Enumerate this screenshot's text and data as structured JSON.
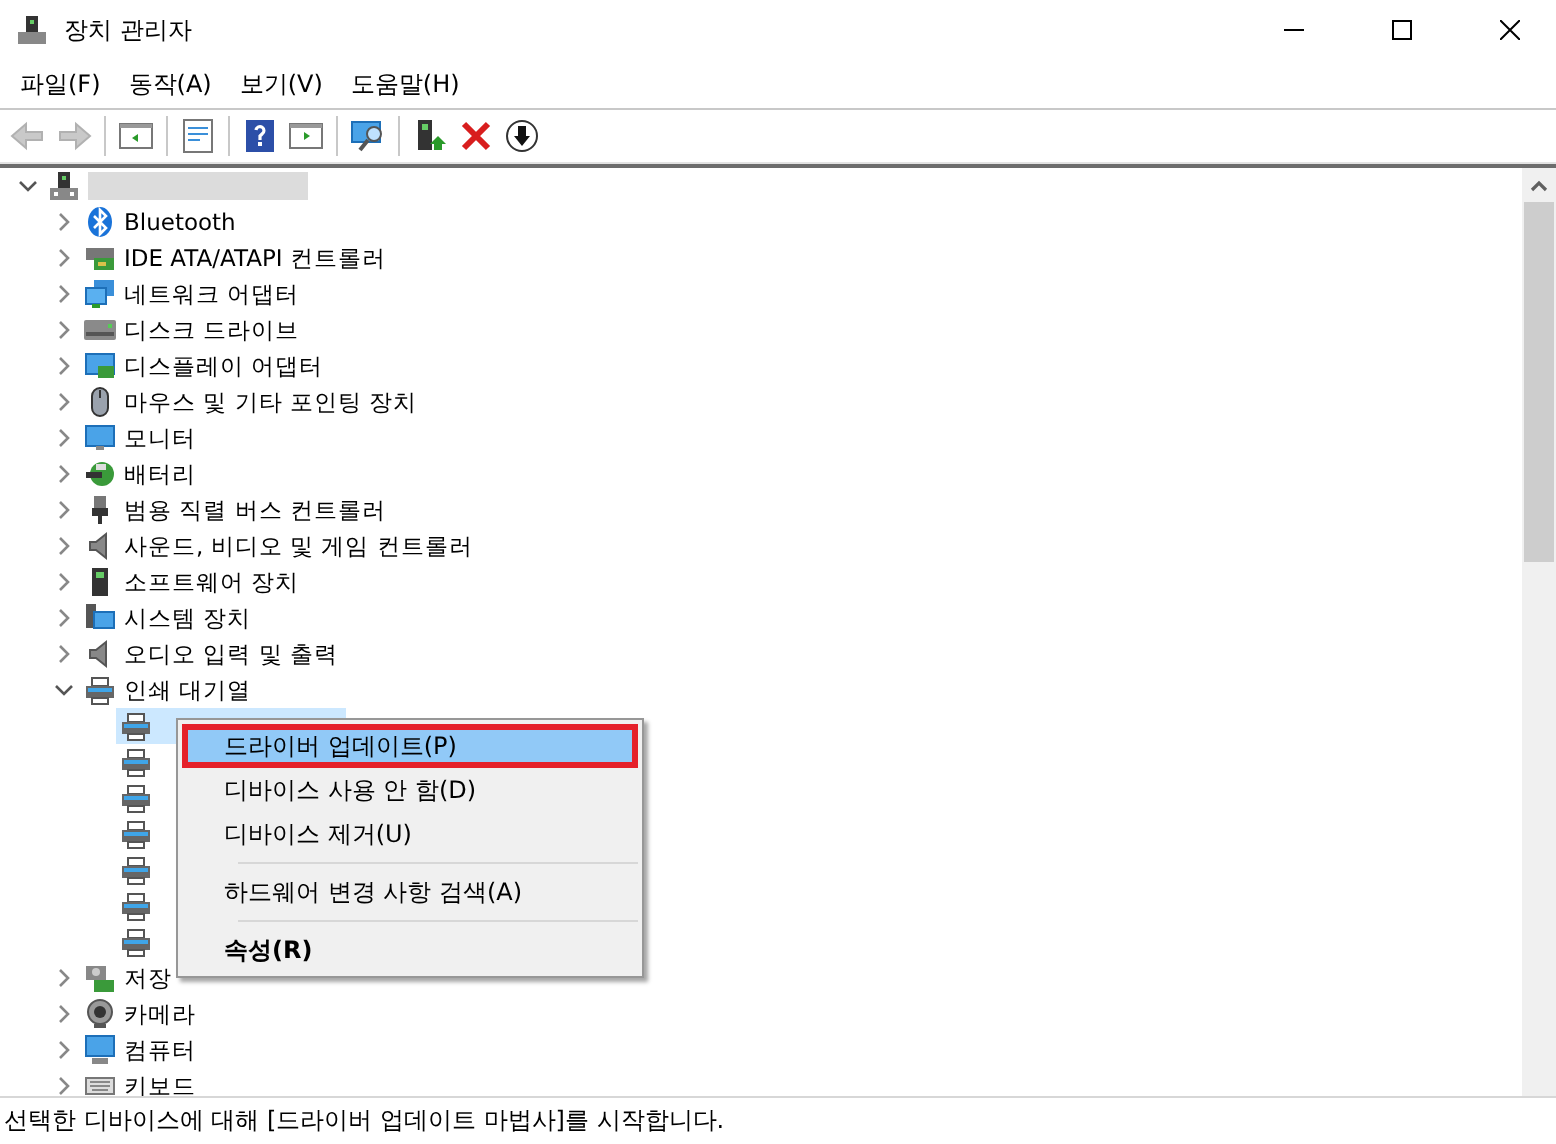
{
  "window": {
    "title": "장치 관리자"
  },
  "menu": [
    "파일(F)",
    "동작(A)",
    "보기(V)",
    "도움말(H)"
  ],
  "toolbar": [
    {
      "kind": "back",
      "disabled": true
    },
    {
      "kind": "forward",
      "disabled": true
    },
    {
      "kind": "separator"
    },
    {
      "kind": "console",
      "disabled": false
    },
    {
      "kind": "separator"
    },
    {
      "kind": "properties",
      "disabled": false
    },
    {
      "kind": "separator"
    },
    {
      "kind": "help",
      "disabled": false
    },
    {
      "kind": "action",
      "disabled": false
    },
    {
      "kind": "separator"
    },
    {
      "kind": "scan",
      "disabled": false
    },
    {
      "kind": "separator"
    },
    {
      "kind": "update",
      "disabled": false
    },
    {
      "kind": "uninstall",
      "disabled": false
    },
    {
      "kind": "download",
      "disabled": false
    }
  ],
  "tree": {
    "kind": "computer-root",
    "expanded": true,
    "children": [
      {
        "kind": "bluetooth",
        "label": "Bluetooth",
        "expanded": false
      },
      {
        "kind": "controller",
        "label": "IDE ATA/ATAPI 컨트롤러",
        "expanded": false
      },
      {
        "kind": "network",
        "label": "네트워크 어댑터",
        "expanded": false
      },
      {
        "kind": "disk",
        "label": "디스크 드라이브",
        "expanded": false
      },
      {
        "kind": "display",
        "label": "디스플레이 어댑터",
        "expanded": false
      },
      {
        "kind": "mouse",
        "label": "마우스 및 기타 포인팅 장치",
        "expanded": false
      },
      {
        "kind": "monitor",
        "label": "모니터",
        "expanded": false
      },
      {
        "kind": "battery",
        "label": "배터리",
        "expanded": false
      },
      {
        "kind": "usb",
        "label": "범용 직렬 버스 컨트롤러",
        "expanded": false
      },
      {
        "kind": "sound",
        "label": "사운드, 비디오 및 게임 컨트롤러",
        "expanded": false
      },
      {
        "kind": "software",
        "label": "소프트웨어 장치",
        "expanded": false
      },
      {
        "kind": "system",
        "label": "시스템 장치",
        "expanded": false
      },
      {
        "kind": "sound",
        "label": "오디오 입력 및 출력",
        "expanded": false
      },
      {
        "kind": "printer",
        "label": "인쇄 대기열",
        "expanded": true,
        "children": [
          {
            "kind": "printer",
            "selected": true
          },
          {
            "kind": "printer",
            "selected": false
          },
          {
            "kind": "printer",
            "selected": false
          },
          {
            "kind": "printer",
            "selected": false
          },
          {
            "kind": "printer",
            "selected": false
          },
          {
            "kind": "printer",
            "selected": false
          },
          {
            "kind": "printer",
            "selected": false
          }
        ]
      },
      {
        "kind": "storage",
        "label": "저장",
        "expanded": false
      },
      {
        "kind": "camera",
        "label": "카메라",
        "expanded": false
      },
      {
        "kind": "computer",
        "label": "컴퓨터",
        "expanded": false
      },
      {
        "kind": "keyboard",
        "label": "키보드",
        "expanded": false
      }
    ]
  },
  "context_menu": [
    {
      "kind": "item",
      "label": "드라이버 업데이트(P)",
      "selected": true,
      "default": false
    },
    {
      "kind": "item",
      "label": "디바이스 사용 안 함(D)",
      "selected": false,
      "default": false
    },
    {
      "kind": "item",
      "label": "디바이스 제거(U)",
      "selected": false,
      "default": false
    },
    {
      "kind": "separator"
    },
    {
      "kind": "item",
      "label": "하드웨어 변경 사항 검색(A)",
      "selected": false,
      "default": false
    },
    {
      "kind": "separator"
    },
    {
      "kind": "item",
      "label": "속성(R)",
      "selected": false,
      "default": true
    }
  ],
  "status_bar": "선택한 디바이스에 대해 [드라이버 업데이트 마법사]를 시작합니다."
}
